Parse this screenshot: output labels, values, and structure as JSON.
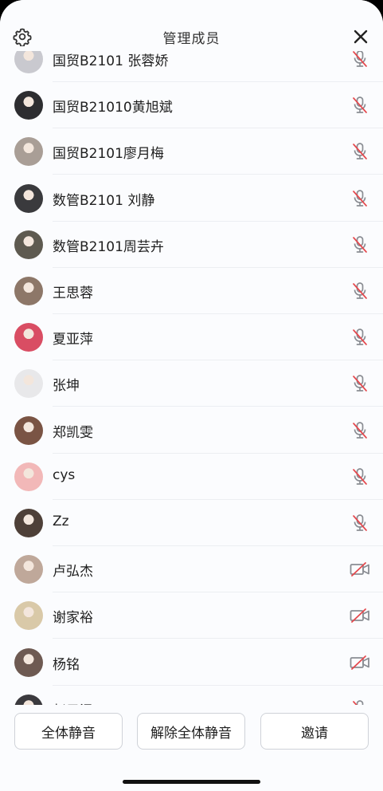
{
  "header": {
    "title": "管理成员",
    "settings_icon": "gear-icon",
    "close_icon": "close-icon"
  },
  "members": [
    {
      "name": "国贸B2101 张蓉娇",
      "status": "mic-muted",
      "avatar": "#c9c9cf"
    },
    {
      "name": "国贸B21010黄旭斌",
      "status": "mic-muted",
      "avatar": "#2d2d30"
    },
    {
      "name": "国贸B2101廖月梅",
      "status": "mic-muted",
      "avatar": "#a99e96"
    },
    {
      "name": "数管B2101 刘静",
      "status": "mic-muted",
      "avatar": "#3a3a3d"
    },
    {
      "name": "数管B2101周芸卉",
      "status": "mic-muted",
      "avatar": "#5e5a50"
    },
    {
      "name": "王思蓉",
      "status": "mic-muted",
      "avatar": "#8d7768"
    },
    {
      "name": "夏亚萍",
      "status": "mic-muted",
      "avatar": "#d94d63"
    },
    {
      "name": "张坤",
      "status": "mic-muted",
      "avatar": "#e8e8ea"
    },
    {
      "name": "郑凯雯",
      "status": "mic-muted",
      "avatar": "#7a5444"
    },
    {
      "name": "cys",
      "status": "mic-muted",
      "avatar": "#f2b8b8"
    },
    {
      "name": "Zz",
      "status": "mic-muted",
      "avatar": "#4e4038"
    },
    {
      "name": "卢弘杰",
      "status": "camera-off",
      "avatar": "#bfa89a"
    },
    {
      "name": "谢家裕",
      "status": "camera-off",
      "avatar": "#d9c9a8"
    },
    {
      "name": "杨铭",
      "status": "camera-off",
      "avatar": "#6e5a52"
    },
    {
      "name": "赵子涵",
      "status": "mic-muted",
      "avatar": "#3b3a3e"
    }
  ],
  "footer": {
    "mute_all_label": "全体静音",
    "unmute_all_label": "解除全体静音",
    "invite_label": "邀请"
  },
  "colors": {
    "muted_red": "#e5484d",
    "icon_gray": "#8a8d93"
  }
}
